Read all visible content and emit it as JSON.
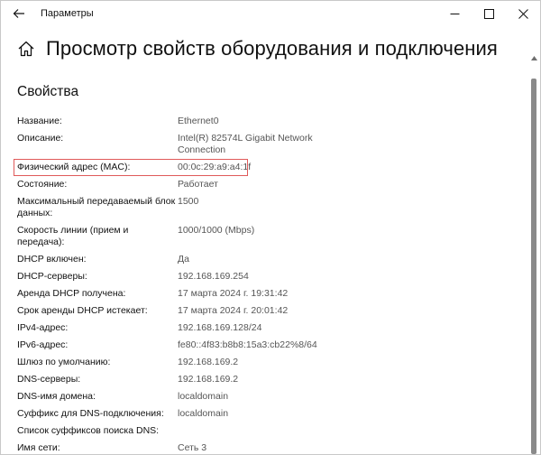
{
  "window": {
    "title": "Параметры"
  },
  "header": {
    "title": "Просмотр свойств оборудования и подключения"
  },
  "section": {
    "title": "Свойства"
  },
  "properties": [
    {
      "label": "Название:",
      "value": "Ethernet0"
    },
    {
      "label": "Описание:",
      "value": "Intel(R) 82574L Gigabit Network Connection"
    },
    {
      "label": "Физический адрес (MAC):",
      "value": "00:0c:29:a9:a4:1f",
      "highlighted": true
    },
    {
      "label": "Состояние:",
      "value": "Работает"
    },
    {
      "label": "Максимальный передаваемый блок данных:",
      "value": "1500"
    },
    {
      "label": "Скорость линии (прием и передача):",
      "value": "1000/1000 (Mbps)"
    },
    {
      "label": "DHCP включен:",
      "value": "Да"
    },
    {
      "label": "DHCP-серверы:",
      "value": "192.168.169.254"
    },
    {
      "label": "Аренда DHCP получена:",
      "value": "17 марта 2024 г. 19:31:42"
    },
    {
      "label": "Срок аренды DHCP истекает:",
      "value": "17 марта 2024 г. 20:01:42"
    },
    {
      "label": "IPv4-адрес:",
      "value": "192.168.169.128/24"
    },
    {
      "label": "IPv6-адрес:",
      "value": "fe80::4f83:b8b8:15a3:cb22%8/64"
    },
    {
      "label": "Шлюз по умолчанию:",
      "value": "192.168.169.2"
    },
    {
      "label": "DNS-серверы:",
      "value": "192.168.169.2"
    },
    {
      "label": "DNS-имя домена:",
      "value": "localdomain"
    },
    {
      "label": "Суффикс для DNS-подключения:",
      "value": "localdomain"
    },
    {
      "label": "Список суффиксов поиска DNS:",
      "value": ""
    },
    {
      "label": "Имя сети:",
      "value": "Сеть 3"
    }
  ],
  "icons": {
    "back": "back-arrow-icon",
    "home": "home-icon",
    "minimize": "minimize-icon",
    "maximize": "maximize-icon",
    "close": "close-icon"
  },
  "colors": {
    "highlight_border": "#e05a5a",
    "value_text": "#555555"
  }
}
